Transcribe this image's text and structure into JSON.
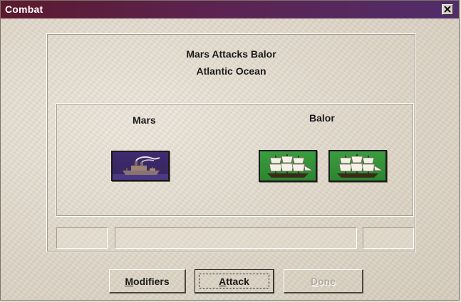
{
  "window": {
    "title": "Combat",
    "close_icon": "close-icon"
  },
  "header": {
    "line1": "Mars Attacks Balor",
    "line2": "Atlantic Ocean"
  },
  "battle": {
    "attacker": {
      "name": "Mars",
      "units": [
        {
          "type": "battleship",
          "icon": "battleship-icon",
          "color": "#3f2a6e"
        }
      ]
    },
    "defender": {
      "name": "Balor",
      "units": [
        {
          "type": "frigate",
          "icon": "sailing-ship-icon",
          "color": "#3a9d3e"
        },
        {
          "type": "frigate",
          "icon": "sailing-ship-icon",
          "color": "#3a9d3e"
        }
      ]
    }
  },
  "status": {
    "left": "",
    "middle": "",
    "right": ""
  },
  "buttons": {
    "modifiers": {
      "hotkey": "M",
      "rest": "odifiers",
      "enabled": true
    },
    "attack": {
      "hotkey": "A",
      "rest": "ttack",
      "enabled": true,
      "focused": true
    },
    "done": {
      "hotkey": "D",
      "rest": "one",
      "enabled": false
    }
  },
  "colors": {
    "titlebar_left": "#5d1a2e",
    "titlebar_right": "#512d6a",
    "attacker_unit": "#3f2a6e",
    "defender_unit": "#3a9d3e"
  }
}
